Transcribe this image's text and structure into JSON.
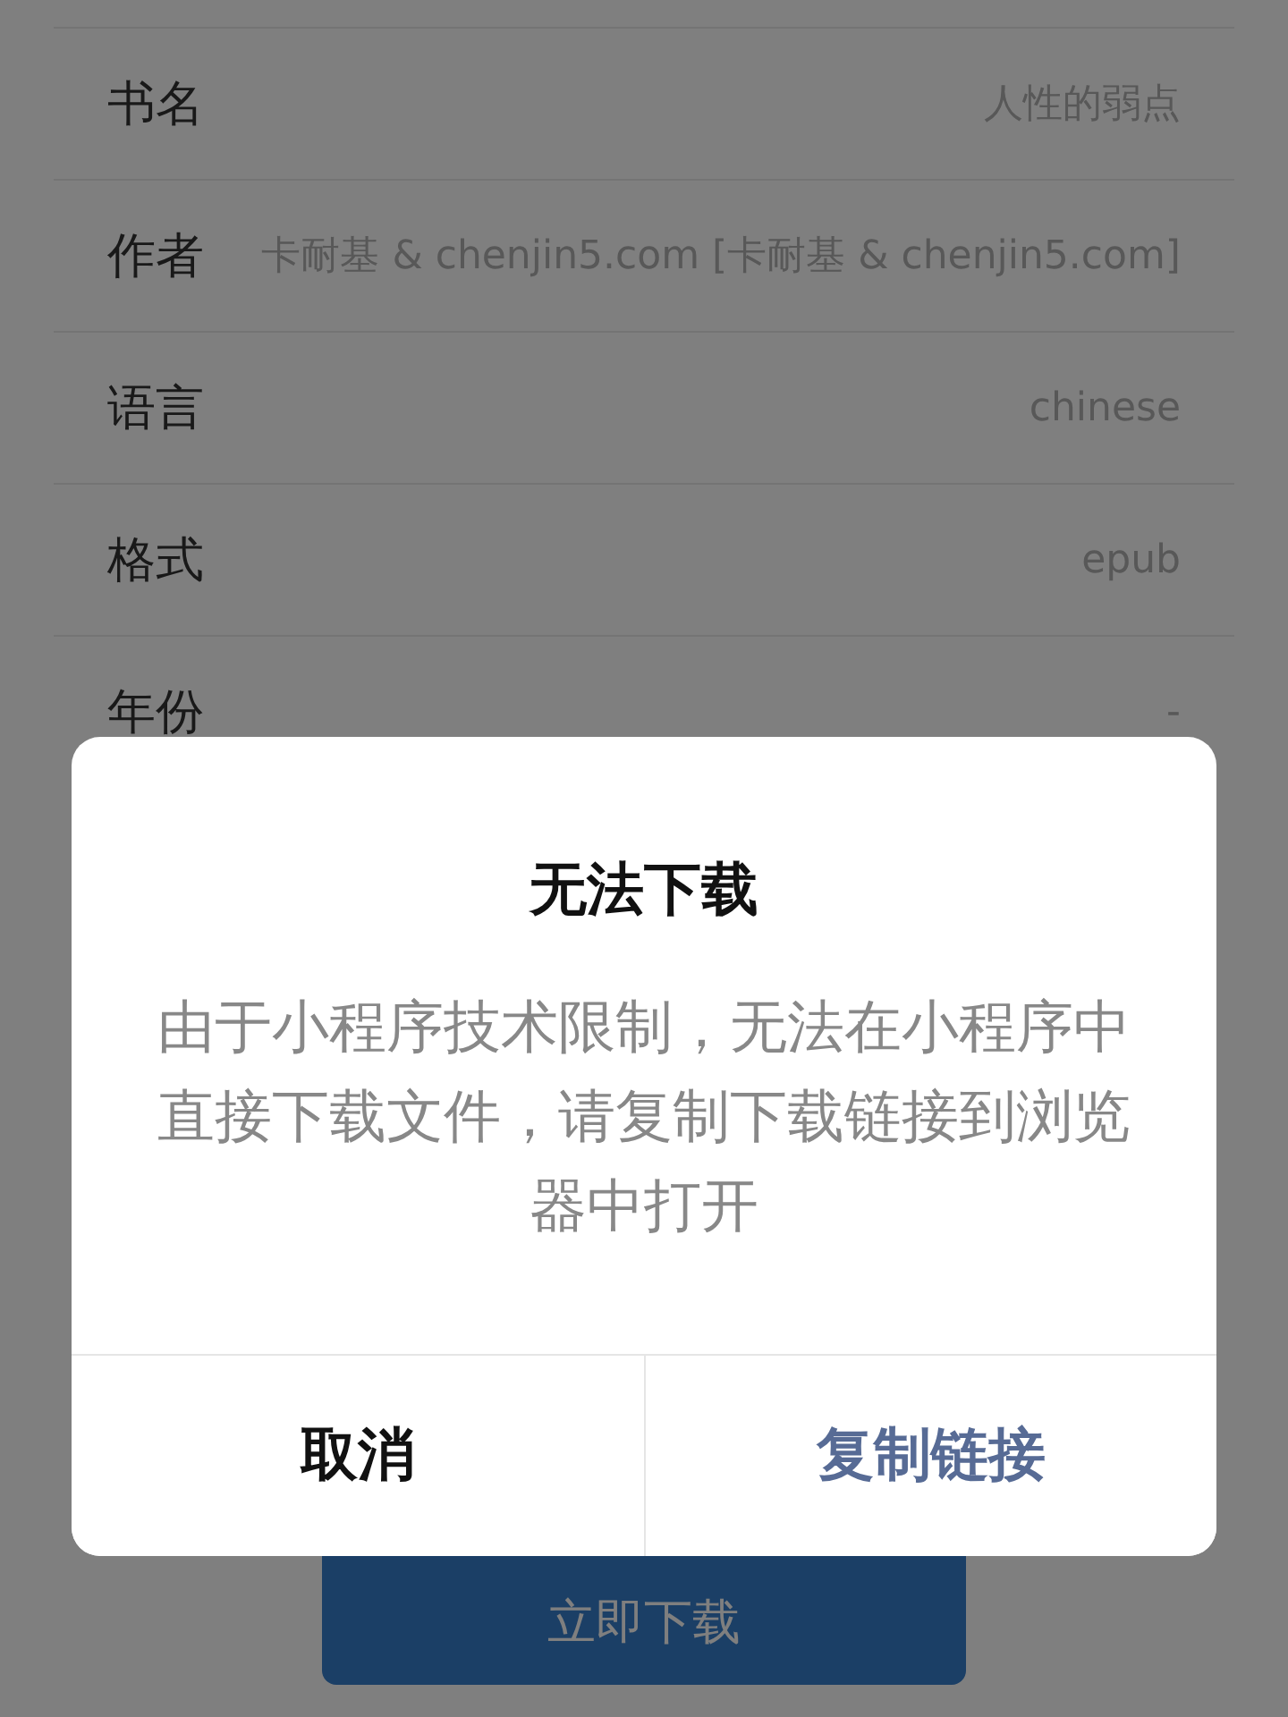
{
  "fields": [
    {
      "label": "书名",
      "value": "人性的弱点"
    },
    {
      "label": "作者",
      "value": "卡耐基 & chenjin5.com [卡耐基 & chenjin5.com]"
    },
    {
      "label": "语言",
      "value": "chinese"
    },
    {
      "label": "格式",
      "value": "epub"
    },
    {
      "label": "年份",
      "value": "-"
    }
  ],
  "download_button": {
    "label": "立即下载"
  },
  "dialog": {
    "title": "无法下载",
    "message": "由于小程序技术限制，无法在小程序中直接下载文件，请复制下载链接到浏览器中打开",
    "buttons": [
      {
        "label": "取消",
        "kind": "cancel"
      },
      {
        "label": "复制链接",
        "kind": "confirm"
      }
    ]
  }
}
